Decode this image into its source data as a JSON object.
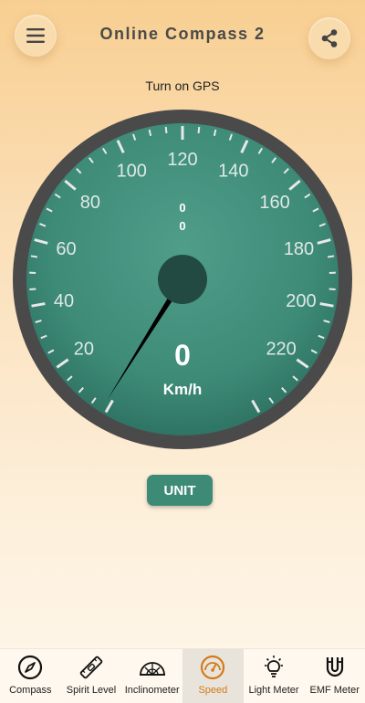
{
  "app": {
    "title": "Online Compass 2"
  },
  "header": {
    "menu_icon": "hamburger-menu-icon",
    "share_icon": "share-icon"
  },
  "status": {
    "gps_message": "Turn on GPS"
  },
  "gauge": {
    "scale_labels": [
      "20",
      "40",
      "60",
      "80",
      "100",
      "120",
      "140",
      "160",
      "180",
      "200",
      "220"
    ],
    "speed": "0",
    "unit": "Km/h",
    "coord_line_1": "0",
    "coord_line_2": "0",
    "colors": {
      "dial": "#3f8c7a",
      "rim": "#4a4a4a",
      "hub": "#234a42",
      "needle": "#000000"
    }
  },
  "unit_button": {
    "label": "UNIT"
  },
  "nav": {
    "active": "Speed",
    "items": [
      {
        "label": "Compass",
        "icon": "compass-icon"
      },
      {
        "label": "Spirit Level",
        "icon": "spirit-level-icon"
      },
      {
        "label": "Inclinometer",
        "icon": "inclinometer-icon"
      },
      {
        "label": "Speed",
        "icon": "speedometer-icon"
      },
      {
        "label": "Light Meter",
        "icon": "light-bulb-icon"
      },
      {
        "label": "EMF Meter",
        "icon": "magnet-icon"
      }
    ]
  },
  "theme": {
    "accent": "#d47a19",
    "button": "#3d8a77"
  }
}
